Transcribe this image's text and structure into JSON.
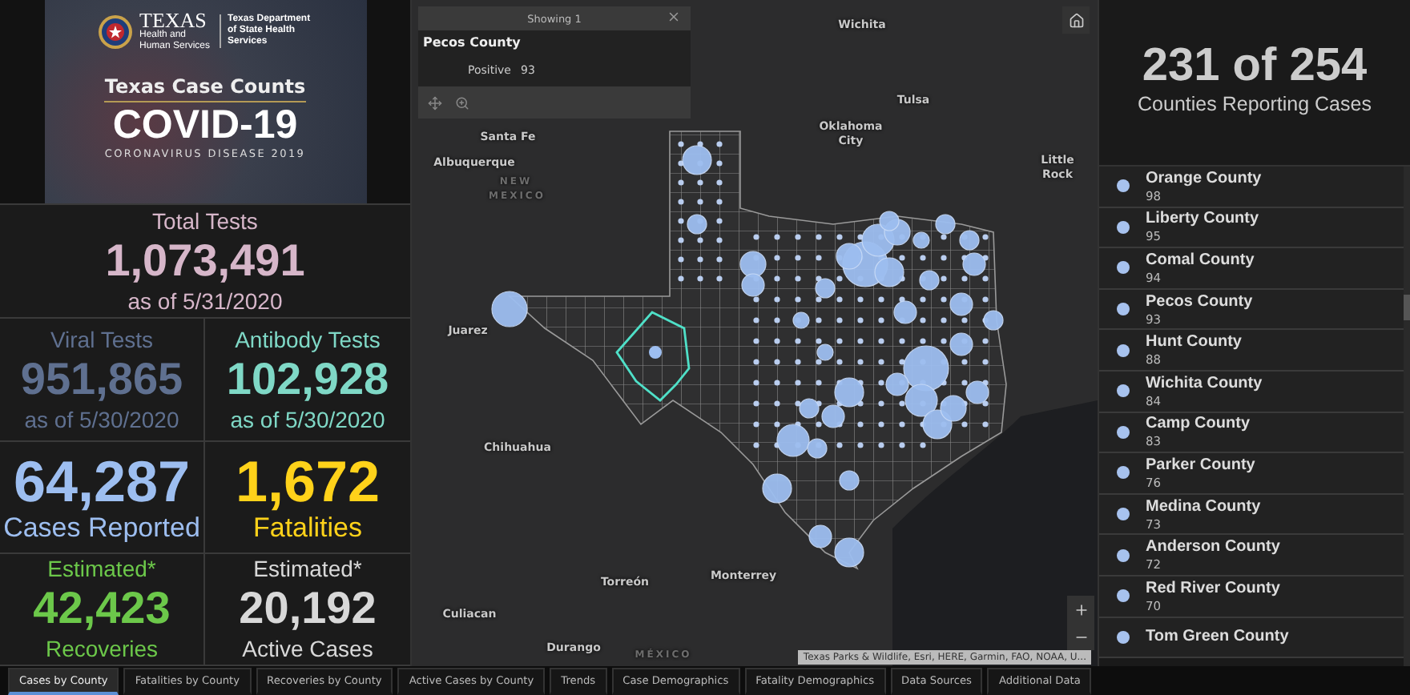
{
  "header": {
    "agency_name": "TEXAS",
    "agency_subtitle": "Health and Human Services",
    "department": "Texas Department of State Health Services",
    "title": "Texas Case Counts",
    "headline": "COVID-19",
    "subtitle": "CORONAVIRUS DISEASE 2019"
  },
  "total_tests": {
    "label": "Total Tests",
    "value": "1,073,491",
    "caption": "as of 5/31/2020",
    "color": "#d6b6c9"
  },
  "stats": [
    {
      "label": "Viral Tests",
      "value": "951,865",
      "caption": "as of 5/30/2020",
      "color": "#5f7090"
    },
    {
      "label": "Antibody Tests",
      "value": "102,928",
      "caption": "as of 5/30/2020",
      "color": "#7fd8c6"
    },
    {
      "value": "64,287",
      "caption": "Cases Reported",
      "color": "#9dbef0"
    },
    {
      "value": "1,672",
      "caption": "Fatalities",
      "color": "#ffd21a"
    },
    {
      "label": "Estimated*",
      "value": "42,423",
      "caption": "Recoveries",
      "color": "#6cc84a"
    },
    {
      "label": "Estimated*",
      "value": "20,192",
      "caption": "Active Cases",
      "color": "#d8d8d8"
    }
  ],
  "map": {
    "popup": {
      "header": "Showing 1",
      "title": "Pecos County",
      "field": "Positive",
      "value": "93"
    },
    "labels": [
      {
        "text": "Wichita",
        "kind": "city"
      },
      {
        "text": "Tulsa",
        "kind": "city"
      },
      {
        "text": "Oklahoma City",
        "kind": "city"
      },
      {
        "text": "Little Rock",
        "kind": "city"
      },
      {
        "text": "Santa Fe",
        "kind": "city"
      },
      {
        "text": "Albuquerque",
        "kind": "city"
      },
      {
        "text": "NEW MEXICO",
        "kind": "region"
      },
      {
        "text": "Juarez",
        "kind": "city"
      },
      {
        "text": "Chihuahua",
        "kind": "city"
      },
      {
        "text": "Torreón",
        "kind": "city"
      },
      {
        "text": "Monterrey",
        "kind": "city"
      },
      {
        "text": "Culiacan",
        "kind": "city"
      },
      {
        "text": "Durango",
        "kind": "city"
      },
      {
        "text": "MÉXICO",
        "kind": "region"
      }
    ],
    "attribution": "Texas Parks & Wildlife, Esri, HERE, Garmin, FAO, NOAA, U..."
  },
  "counties_summary": {
    "value": "231 of 254",
    "label": "Counties Reporting Cases"
  },
  "counties": [
    {
      "name": "Orange County",
      "count": "98"
    },
    {
      "name": "Liberty County",
      "count": "95"
    },
    {
      "name": "Comal County",
      "count": "94"
    },
    {
      "name": "Pecos County",
      "count": "93"
    },
    {
      "name": "Hunt County",
      "count": "88"
    },
    {
      "name": "Wichita County",
      "count": "84"
    },
    {
      "name": "Camp County",
      "count": "83"
    },
    {
      "name": "Parker County",
      "count": "76"
    },
    {
      "name": "Medina County",
      "count": "73"
    },
    {
      "name": "Anderson County",
      "count": "72"
    },
    {
      "name": "Red River County",
      "count": "70"
    },
    {
      "name": "Tom Green County"
    }
  ],
  "tabs": [
    {
      "label": "Cases by County",
      "selected": true
    },
    {
      "label": "Fatalities by County",
      "selected": false
    },
    {
      "label": "Recoveries by County",
      "selected": false
    },
    {
      "label": "Active Cases by County",
      "selected": false
    },
    {
      "label": "Trends",
      "selected": false
    },
    {
      "label": "Case Demographics",
      "selected": false
    },
    {
      "label": "Fatality Demographics",
      "selected": false
    },
    {
      "label": "Data Sources",
      "selected": false
    },
    {
      "label": "Additional Data",
      "selected": false
    }
  ]
}
